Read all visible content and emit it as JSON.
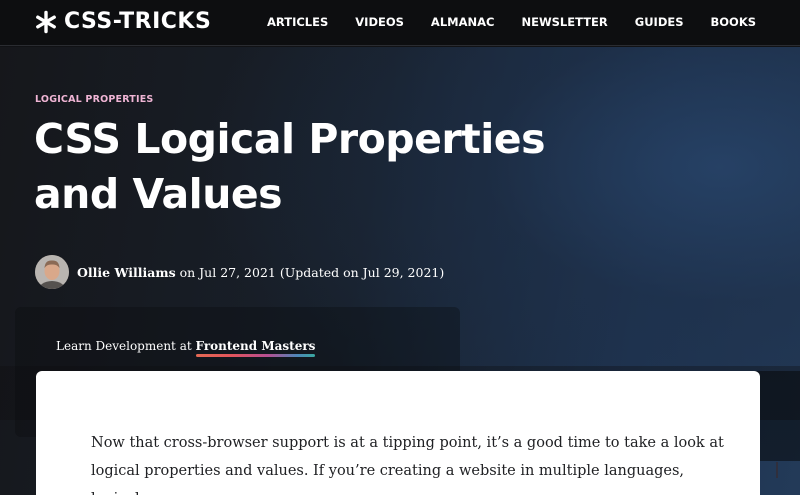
{
  "header": {
    "logo_text": "CSS-TRICKS",
    "logo_icon": "asterisk-star-icon",
    "nav": [
      "ARTICLES",
      "VIDEOS",
      "ALMANAC",
      "NEWSLETTER",
      "GUIDES",
      "BOOKS"
    ]
  },
  "article": {
    "category": "LOGICAL PROPERTIES",
    "title_line1": "CSS Logical Properties",
    "title_line2": "and Values",
    "author": "Ollie Williams",
    "date_text": "on Jul 27, 2021 (Updated on Jul 29, 2021)",
    "avatar_icon": "author-avatar"
  },
  "promo": {
    "prefix": "Learn Development at",
    "link": "Frontend Masters"
  },
  "body": {
    "line1": "Now that cross-browser support is at a tipping point, it’s a good time to take a look at",
    "line2": "logical properties and values. If you’re creating a website in multiple languages, logical"
  },
  "colors": {
    "background": "#111215",
    "hero_blue": "#233a58",
    "category_pink": "#f0b5d5",
    "card": "#ffffff",
    "body_text": "#202124"
  }
}
